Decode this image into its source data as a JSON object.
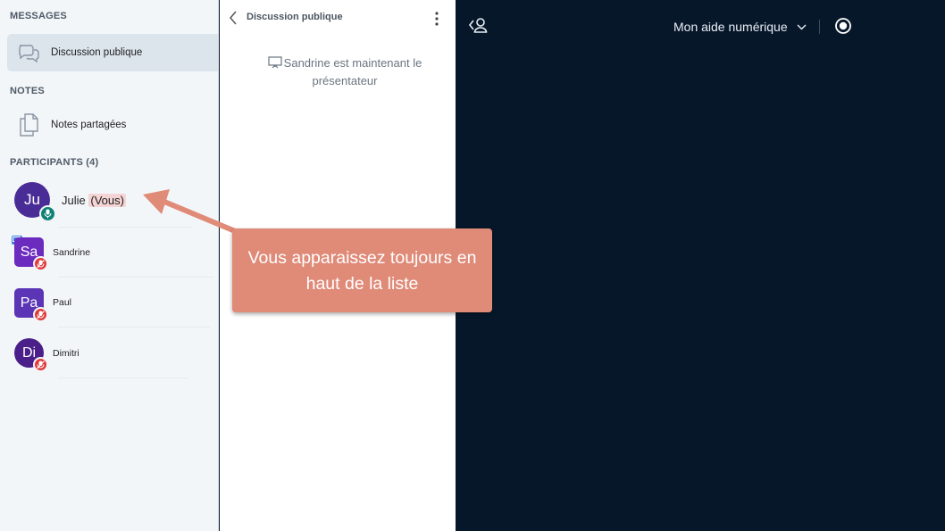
{
  "sidebar": {
    "messages_title": "MESSAGES",
    "public_chat_label": "Discussion publique",
    "notes_title": "NOTES",
    "shared_notes_label": "Notes partagées",
    "participants_title": "PARTICIPANTS (4)",
    "participants": [
      {
        "initials": "Ju",
        "name": "Julie",
        "suffix": "(Vous)",
        "color": "#4a2c97",
        "status": "microphone-active"
      },
      {
        "initials": "Sa",
        "name": "Sandrine",
        "color": "#6c2bbf",
        "status": "presenter"
      },
      {
        "initials": "Pa",
        "name": "Paul",
        "color": "#5b35b5"
      },
      {
        "initials": "Di",
        "name": "Dimitri",
        "color": "#4a1f8a"
      }
    ]
  },
  "chat": {
    "title": "Discussion publique",
    "system_message": "Sandrine est maintenant le présentateur"
  },
  "stage": {
    "meeting_title": "Mon aide numérique"
  },
  "callout": {
    "text": "Vous apparaissez toujours en haut de la liste"
  },
  "colors": {
    "accent_teal": "#0f8074",
    "muted_red": "#e03b3b",
    "presenter_blue": "#3a7de0",
    "callout": "#e08a78",
    "stage_bg": "#06172a"
  }
}
